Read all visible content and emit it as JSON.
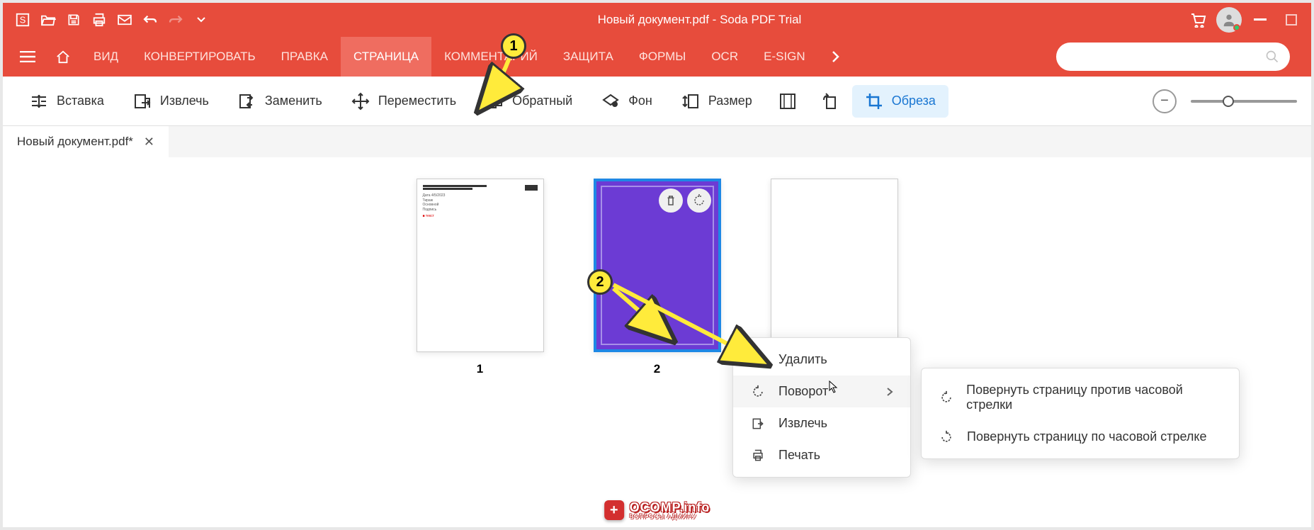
{
  "titlebar": {
    "title": "Новый документ.pdf   -   Soda PDF Trial"
  },
  "menu": {
    "items": [
      "ВИД",
      "КОНВЕРТИРОВАТЬ",
      "ПРАВКА",
      "СТРАНИЦА",
      "КОММЕНТАРИЙ",
      "ЗАЩИТА",
      "ФОРМЫ",
      "OCR",
      "E-SIGN"
    ],
    "active_index": 3
  },
  "toolbar": {
    "insert": "Вставка",
    "extract": "Извлечь",
    "replace": "Заменить",
    "move": "Переместить",
    "reverse": "Обратный",
    "background": "Фон",
    "resize": "Размер",
    "crop": "Обреза"
  },
  "tab": {
    "name": "Новый документ.pdf*"
  },
  "pages": {
    "p1_label": "1",
    "p2_label": "2"
  },
  "context": {
    "delete": "Удалить",
    "rotate": "Поворот",
    "extract": "Извлечь",
    "print": "Печать"
  },
  "submenu": {
    "ccw": "Повернуть страницу против часовой стрелки",
    "cw": "Повернуть страницу по часовой стрелке"
  },
  "callouts": {
    "one": "1",
    "two": "2"
  },
  "watermark": {
    "main": "OCOMP.info",
    "sub": "ВОПРОСЫ АДМИНУ",
    "plus": "+"
  }
}
